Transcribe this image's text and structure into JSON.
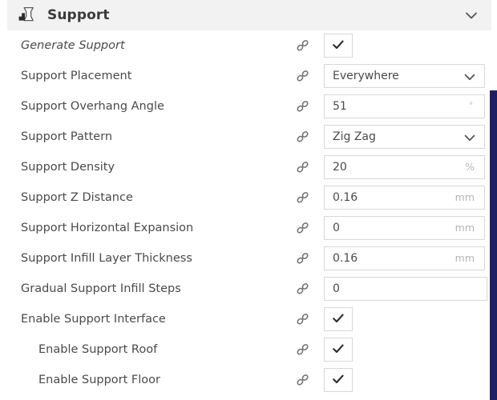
{
  "panel": {
    "category": {
      "title": "Support",
      "icon": "support-icon",
      "collapse_icon": "chevron-down-icon",
      "expanded": true
    },
    "link_icon_name": "link-chain-icon",
    "colors": {
      "header_background": "#f2f2f2",
      "panel_background": "#ffffff",
      "label_text": "#4a4a4a",
      "title_text": "#3a3a3a",
      "field_border": "#d8d8d8",
      "unit_text": "#b4b4b4",
      "side_bar": "#1d2060"
    },
    "settings": [
      {
        "label": "Generate Support",
        "italic": true,
        "indent": 0,
        "control": "checkbox",
        "checked": true,
        "value": "",
        "unit": ""
      },
      {
        "label": "Support Placement",
        "italic": false,
        "indent": 0,
        "control": "dropdown",
        "checked": false,
        "value": "Everywhere",
        "unit": ""
      },
      {
        "label": "Support Overhang Angle",
        "italic": false,
        "indent": 0,
        "control": "text",
        "checked": false,
        "value": "51",
        "unit": "°"
      },
      {
        "label": "Support Pattern",
        "italic": false,
        "indent": 0,
        "control": "dropdown",
        "checked": false,
        "value": "Zig Zag",
        "unit": ""
      },
      {
        "label": "Support Density",
        "italic": false,
        "indent": 0,
        "control": "text",
        "checked": false,
        "value": "20",
        "unit": "%"
      },
      {
        "label": "Support Z Distance",
        "italic": false,
        "indent": 0,
        "control": "text",
        "checked": false,
        "value": "0.16",
        "unit": "mm"
      },
      {
        "label": "Support Horizontal Expansion",
        "italic": false,
        "indent": 0,
        "control": "text",
        "checked": false,
        "value": "0",
        "unit": "mm"
      },
      {
        "label": "Support Infill Layer Thickness",
        "italic": false,
        "indent": 0,
        "control": "text",
        "checked": false,
        "value": "0.16",
        "unit": "mm"
      },
      {
        "label": "Gradual Support Infill Steps",
        "italic": false,
        "indent": 0,
        "control": "text-wide",
        "checked": false,
        "value": "0",
        "unit": ""
      },
      {
        "label": "Enable Support Interface",
        "italic": false,
        "indent": 0,
        "control": "checkbox",
        "checked": true,
        "value": "",
        "unit": ""
      },
      {
        "label": "Enable Support Roof",
        "italic": false,
        "indent": 1,
        "control": "checkbox",
        "checked": true,
        "value": "",
        "unit": ""
      },
      {
        "label": "Enable Support Floor",
        "italic": false,
        "indent": 1,
        "control": "checkbox",
        "checked": true,
        "value": "",
        "unit": ""
      }
    ]
  }
}
